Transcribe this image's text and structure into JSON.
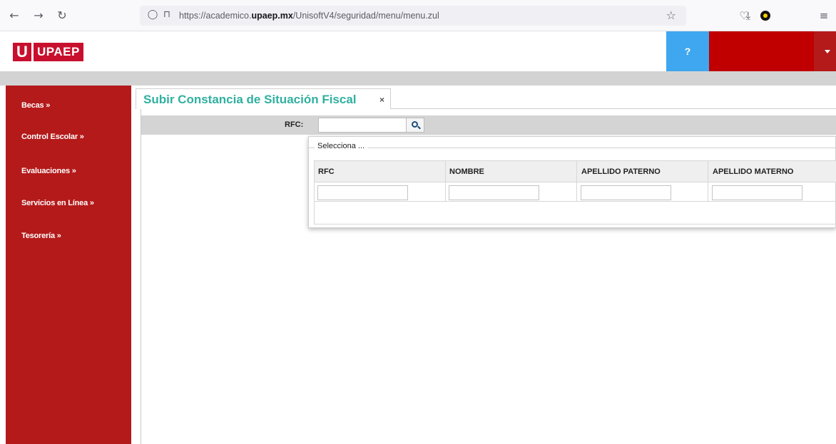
{
  "browser": {
    "url_prefix": "https://academico.",
    "url_domain": "upaep.mx",
    "url_path": "/UnisoftV4/seguridad/menu/menu.zul",
    "icons": [
      "back-arrow-icon",
      "forward-arrow-icon",
      "reload-icon",
      "shield-icon",
      "lock-icon",
      "star-icon",
      "pocket-icon",
      "download-icon",
      "extension-icon",
      "menu-icon"
    ]
  },
  "header": {
    "logo_u": "U",
    "logo_text": "UPAEP",
    "help_label": "?",
    "colors": {
      "brand_red": "#c8102e",
      "sidebar_red": "#b41a1a",
      "help_blue": "#3fa7f0",
      "title_teal": "#2fb0a0"
    }
  },
  "sidebar": {
    "items": [
      {
        "label": "Becas »"
      },
      {
        "label": "Control Escolar »"
      },
      {
        "label": "Evaluaciones »"
      },
      {
        "label": "Servicios en Línea »"
      },
      {
        "label": "Tesorería »"
      }
    ]
  },
  "main": {
    "tab_title": "Subir Constancia de Situación Fiscal",
    "tab_close": "×",
    "rfc_label": "RFC:",
    "rfc_value": ""
  },
  "popup": {
    "legend": "Selecciona ...",
    "columns": [
      "RFC",
      "NOMBRE",
      "APELLIDO PATERNO",
      "APELLIDO MATERNO"
    ],
    "filters": [
      "",
      "",
      "",
      ""
    ]
  }
}
